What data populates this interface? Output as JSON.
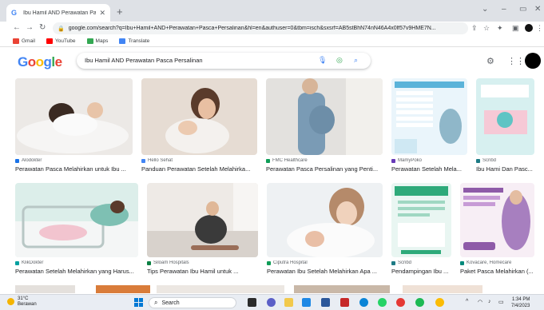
{
  "browser": {
    "tab_title": "Ibu Hamil AND Perawatan Pasca ...",
    "tab_favicon": "G",
    "new_tab": "+",
    "url": "google.com/search?q=Ibu+Hamil+AND+Perawatan+Pasca+Persalinan&hl=en&authuser=0&tbm=isch&sxsrf=AB5stBhN74nN46A4x0lf57v9HME7N...",
    "bookmarks": [
      {
        "label": "Gmail",
        "color": "#ea4335"
      },
      {
        "label": "YouTube",
        "color": "#ff0000"
      },
      {
        "label": "Maps",
        "color": "#34a853"
      },
      {
        "label": "Translate",
        "color": "#4285f4"
      }
    ]
  },
  "google": {
    "logo_letters": [
      "G",
      "o",
      "o",
      "g",
      "l",
      "e"
    ],
    "logo_colors": [
      "#4285f4",
      "#ea4335",
      "#fbbc05",
      "#4285f4",
      "#34a853",
      "#ea4335"
    ],
    "query": "Ibu Hamil AND Perawatan Pasca Persalinan"
  },
  "results": [
    {
      "source": "Alodokter",
      "caption": "Perawatan Pasca Melahirkan untuk Ibu ...",
      "src_color": "#1a73e8"
    },
    {
      "source": "Hello Sehat",
      "caption": "Panduan Perawatan Setelah Melahirka...",
      "src_color": "#4285f4"
    },
    {
      "source": "FMC Healthcare",
      "caption": "Perawatan Pasca Persalinan yang Penti...",
      "src_color": "#0f9d58"
    },
    {
      "source": "MamyPoko",
      "caption": "Perawatan Setelah Mela...",
      "src_color": "#673ab7"
    },
    {
      "source": "Scribd",
      "caption": "Ibu Hami Dan Pasc...",
      "src_color": "#1e7b85"
    },
    {
      "source": "KlikDokter",
      "caption": "Perawatan Setelah Melahirkan yang Harus...",
      "src_color": "#00a0a0"
    },
    {
      "source": "Siloam Hospitals",
      "caption": "Tips Perawatan Ibu Hamil untuk ...",
      "src_color": "#0b8043"
    },
    {
      "source": "Ciputra Hospital",
      "caption": "Perawatan Ibu Setelah Melahirkan Apa ...",
      "src_color": "#0f9d58"
    },
    {
      "source": "Scribd",
      "caption": "Pendampingan Ibu ...",
      "src_color": "#1e7b85"
    },
    {
      "source": "Kovacare, Homecare",
      "caption": "Paket Pasca Melahirkan (...",
      "src_color": "#00897b"
    }
  ],
  "taskbar": {
    "weather_temp": "31°C",
    "weather_desc": "Berawan",
    "search_label": "Search",
    "time": "1:34 PM",
    "date": "7/4/2023"
  },
  "colors": {
    "accent": "#1a73e8",
    "tabbar": "#dee1e6"
  }
}
